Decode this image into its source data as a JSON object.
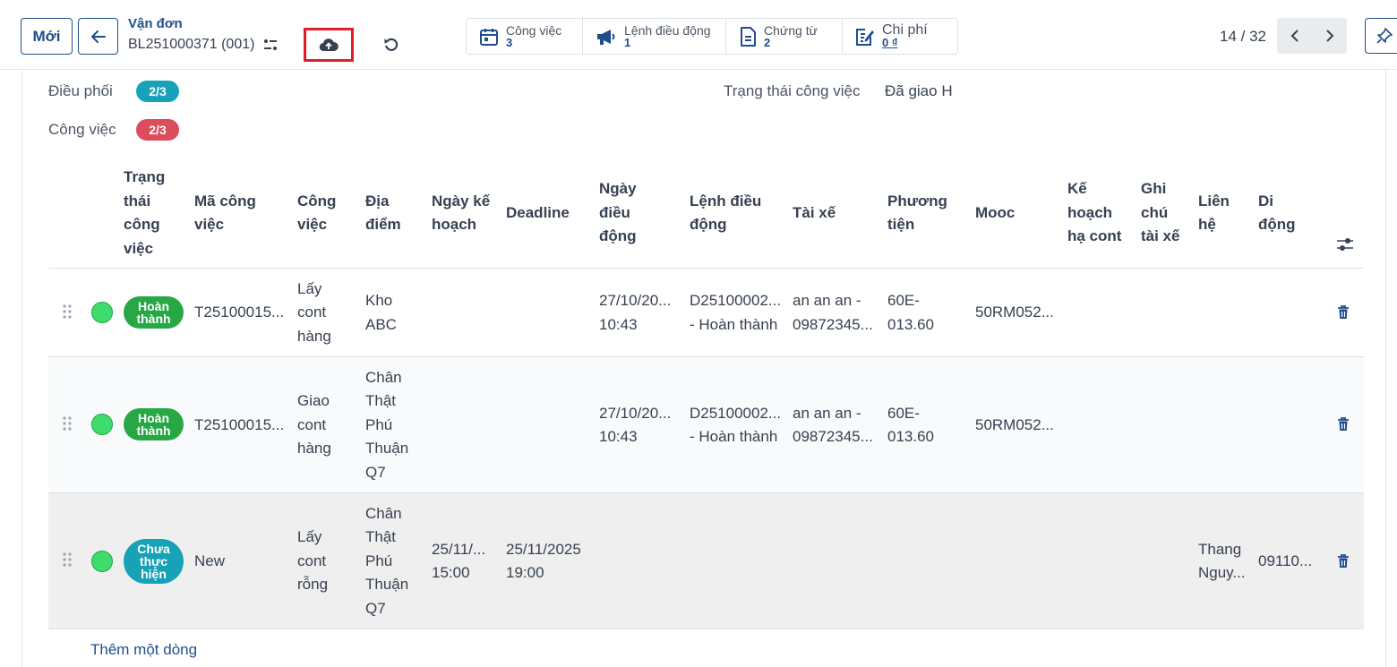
{
  "toolbar": {
    "new_label": "Mới",
    "breadcrumb_parent": "Vận đơn",
    "record_name": "BL251000371 (001)",
    "smart_buttons": [
      {
        "label": "Công việc",
        "value": "3",
        "icon": "calendar-icon"
      },
      {
        "label": "Lệnh điều động",
        "value": "1",
        "icon": "megaphone-icon"
      },
      {
        "label": "Chứng từ",
        "value": "2",
        "icon": "document-icon"
      },
      {
        "label": "Chi phí",
        "value": "0 ₫",
        "icon": "edit-note-icon"
      }
    ],
    "pager": "14 / 32"
  },
  "form": {
    "dispatch_label": "Điều phối",
    "dispatch_value": "2/3",
    "task_label": "Công việc",
    "task_value": "2/3",
    "status_label": "Trạng thái công việc",
    "status_value": "Đã giao H"
  },
  "table": {
    "headers": [
      "Trạng thái công việc",
      "Mã công việc",
      "Công việc",
      "Địa điểm",
      "Ngày kế hoạch",
      "Deadline",
      "Ngày điều động",
      "Lệnh điều động",
      "Tài xế",
      "Phương tiện",
      "Mooc",
      "Kế hoạch hạ cont",
      "Ghi chú tài xế",
      "Liên hệ",
      "Di động"
    ],
    "rows": [
      {
        "status": "Hoàn thành",
        "code": "T25100015...",
        "task": "Lấy cont hàng",
        "location": "Kho ABC",
        "plan_date": "",
        "deadline": "",
        "dispatch_date": "27/10/20... 10:43",
        "order": "D25100002... - Hoàn thành",
        "driver": "an an an - 09872345...",
        "vehicle": "60E-013.60",
        "mooc": "50RM052...",
        "cont_plan": "",
        "driver_note": "",
        "contact": "",
        "mobile": ""
      },
      {
        "status": "Hoàn thành",
        "code": "T25100015...",
        "task": "Giao cont hàng",
        "location": "Chân Thật Phú Thuận Q7",
        "plan_date": "",
        "deadline": "",
        "dispatch_date": "27/10/20... 10:43",
        "order": "D25100002... - Hoàn thành",
        "driver": "an an an - 09872345...",
        "vehicle": "60E-013.60",
        "mooc": "50RM052...",
        "cont_plan": "",
        "driver_note": "",
        "contact": "",
        "mobile": ""
      },
      {
        "status": "Chưa thực hiện",
        "code": "New",
        "task": "Lấy cont rỗng",
        "location": "Chân Thật Phú Thuận Q7",
        "plan_date": "25/11/... 15:00",
        "deadline": "25/11/2025 19:00",
        "dispatch_date": "",
        "order": "",
        "driver": "",
        "vehicle": "",
        "mooc": "",
        "cont_plan": "",
        "driver_note": "",
        "contact": "Thang Nguy...",
        "mobile": "09110..."
      }
    ],
    "add_line": "Thêm một dòng"
  },
  "colors": {
    "brand": "#1f4e8c",
    "dispatch_pill": "#17a2b8",
    "task_pill": "#dc4c5a",
    "done_badge": "#28a745",
    "pending_badge": "#17a2b8",
    "highlight_border": "#e11d2a"
  }
}
